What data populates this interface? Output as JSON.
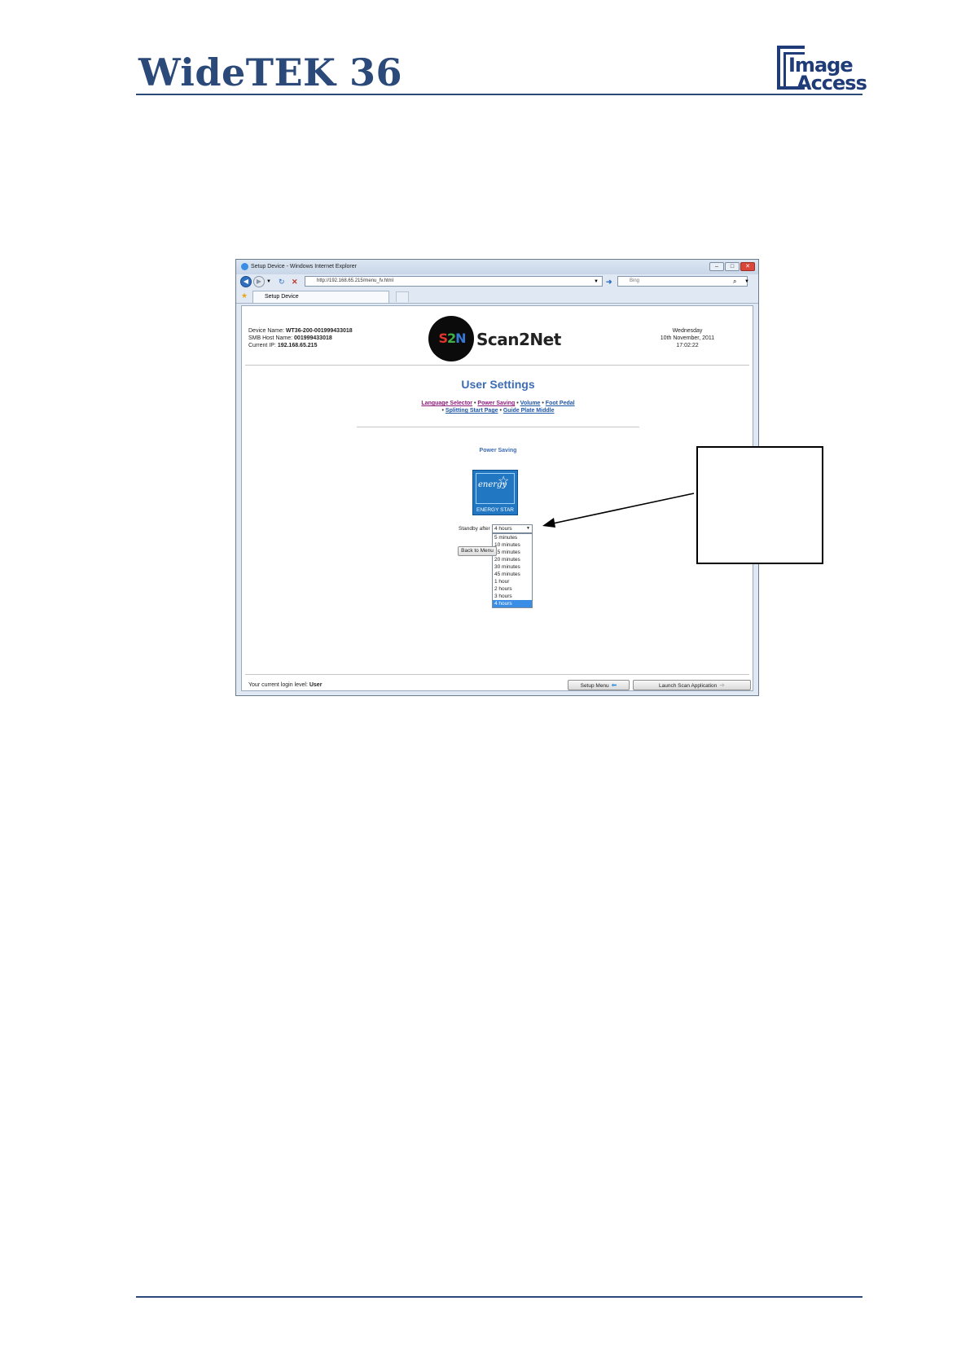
{
  "document": {
    "title": "WideTEK 36",
    "logo_line1": "Image",
    "logo_line2": "Access"
  },
  "browser": {
    "window_title": "Setup Device - Windows Internet Explorer",
    "address": "http://192.168.65.215/menu_fv.html",
    "search_placeholder": "Bing",
    "tab_label": "Setup Device"
  },
  "page": {
    "device_name_label": "Device Name:",
    "device_name": "WT36-200-001999433018",
    "smb_label": "SMB Host Name:",
    "smb_name": "001999433018",
    "ip_label": "Current IP:",
    "ip": "192.168.65.215",
    "brand": "Scan2Net",
    "brand_mark": "S2N",
    "weekday": "Wednesday",
    "date": "10th November, 2011",
    "time": "17:02:22",
    "heading": "User Settings",
    "links": {
      "language": "Language Selector",
      "power": "Power Saving",
      "volume": "Volume",
      "foot": "Foot Pedal",
      "splitting": "Splitting Start Page",
      "guide": "Guide Plate Middle"
    },
    "section_title": "Power Saving",
    "energy_star_label": "ENERGY STAR",
    "energy_script": "energy",
    "standby_label": "Standby after",
    "standby_value": "4 hours",
    "standby_options": [
      "5 minutes",
      "10 minutes",
      "15 minutes",
      "20 minutes",
      "30 minutes",
      "45 minutes",
      "1 hour",
      "2 hours",
      "3 hours",
      "4 hours"
    ],
    "back_button": "Back to Menu",
    "login_label": "Your current login level:",
    "login_level": "User",
    "setup_menu_button": "Setup Menu",
    "launch_button": "Launch Scan Application"
  }
}
